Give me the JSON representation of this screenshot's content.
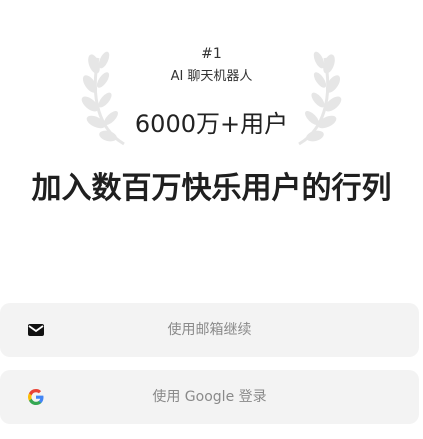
{
  "award": {
    "rank": "#1",
    "subtitle": "AI 聊天机器人",
    "users": "6000万+用户"
  },
  "headline": "加入数百万快乐用户的行列",
  "buttons": {
    "email_label": "使用邮箱继续",
    "google_label": "使用 Google 登录"
  },
  "icons": {
    "email": "envelope-icon",
    "google": "google-g-icon",
    "laurel": "laurel-wreath-icon"
  },
  "colors": {
    "button_bg": "#f3f3f3",
    "button_text": "#8a8a8a",
    "laurel": "#e3e3e3",
    "headline": "#1f1f1f"
  }
}
